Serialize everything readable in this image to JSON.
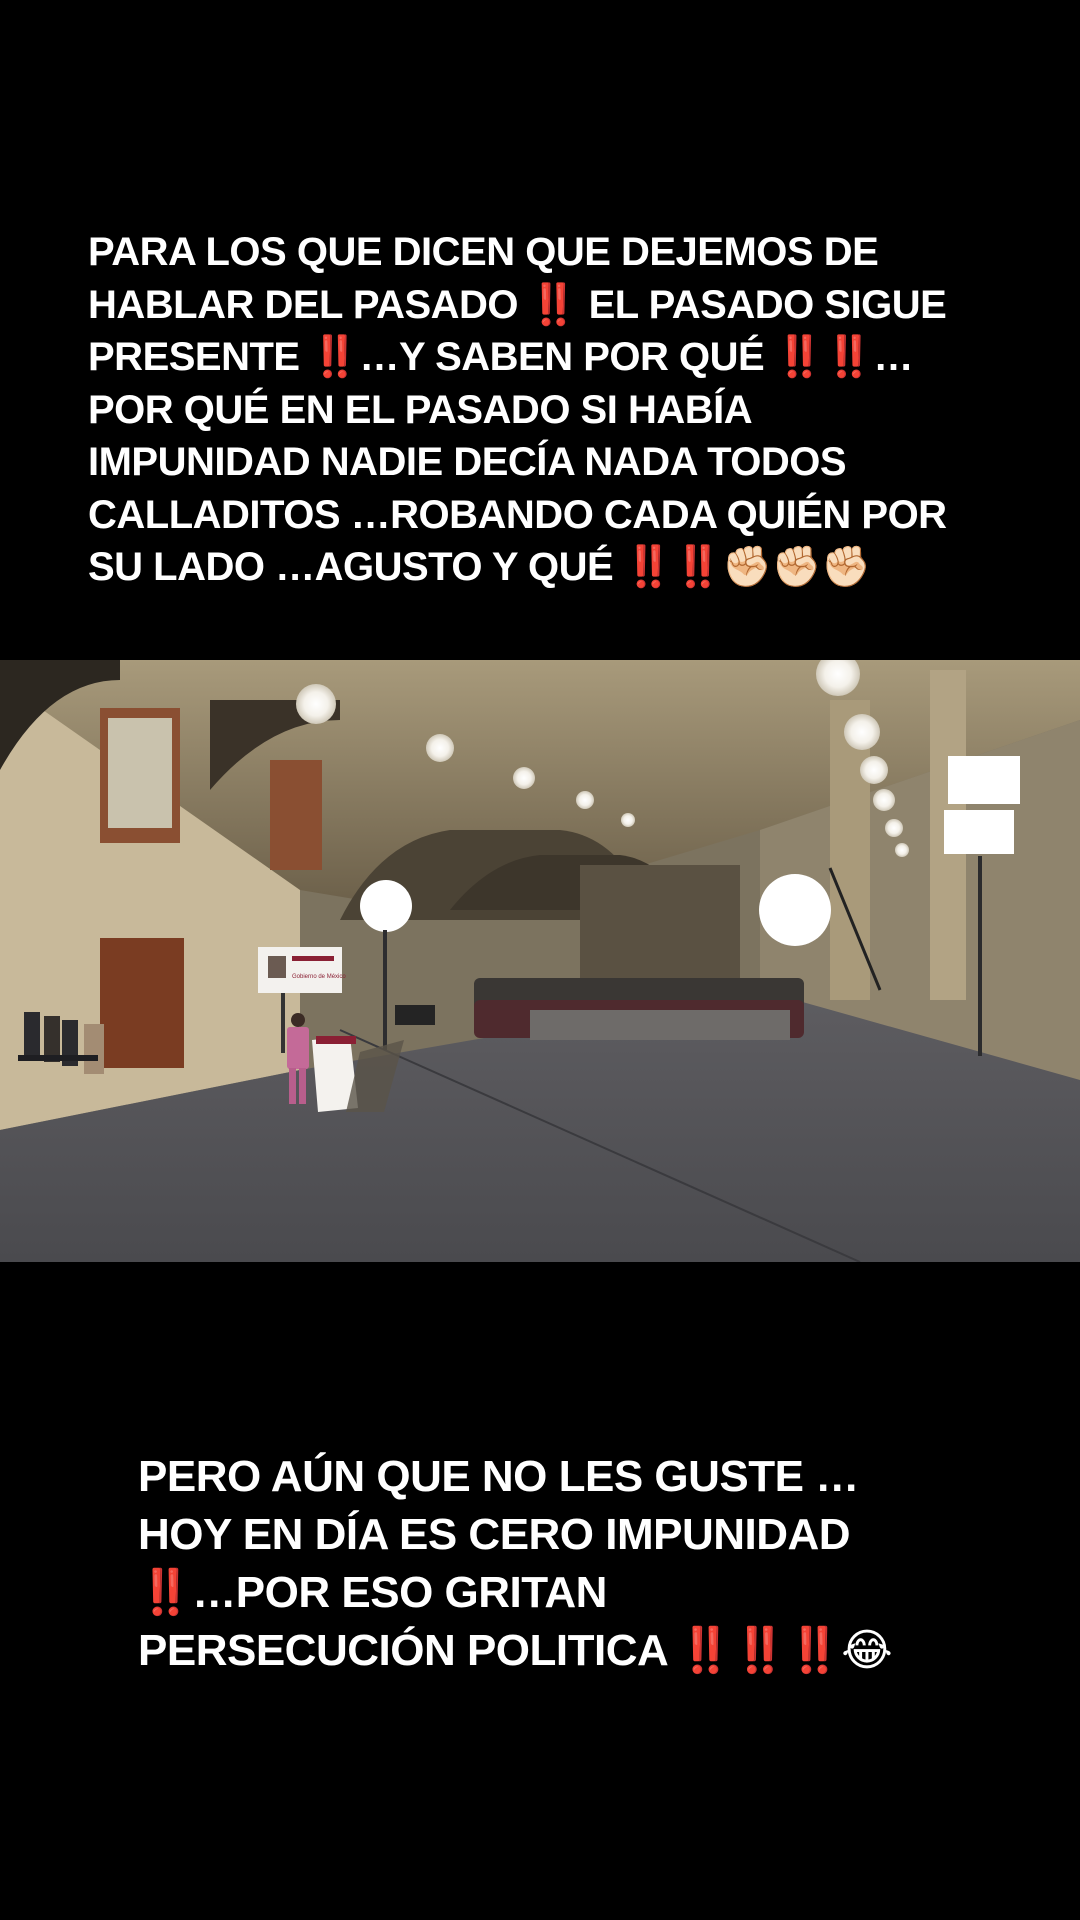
{
  "caption_top": {
    "lines": [
      "PARA  LOS QUE DICEN QUE DEJEMOS DE",
      "HABLAR DEL PASADO ‼️ EL PASADO SIGUE",
      "PRESENTE ‼️…Y SABEN POR QUÉ ‼️‼️…",
      "POR QUÉ EN EL PASADO SI HABÍA",
      "IMPUNIDAD NADIE DECÍA NADA TODOS",
      "CALLADITOS …ROBANDO CADA QUIÉN POR",
      "SU LADO …AGUSTO Y QUÉ ‼️‼️✊🏻✊🏻✊🏻"
    ]
  },
  "caption_bottom": {
    "lines": [
      "PERO AÚN QUE NO LES GUSTE …",
      "HOY EN DÍA ES CERO IMPUNIDAD",
      "‼️…POR ESO GRITAN",
      "PERSECUCIÓN POLITICA ‼️‼️‼️😂"
    ]
  },
  "video": {
    "screen_text": "Gobierno de México",
    "colors": {
      "ceiling": "#b9ab8a",
      "floor": "#55555a",
      "wall": "#c8b99a",
      "speaker_suit": "#c46a98",
      "interpreter_dress": "#8e1f33"
    }
  }
}
